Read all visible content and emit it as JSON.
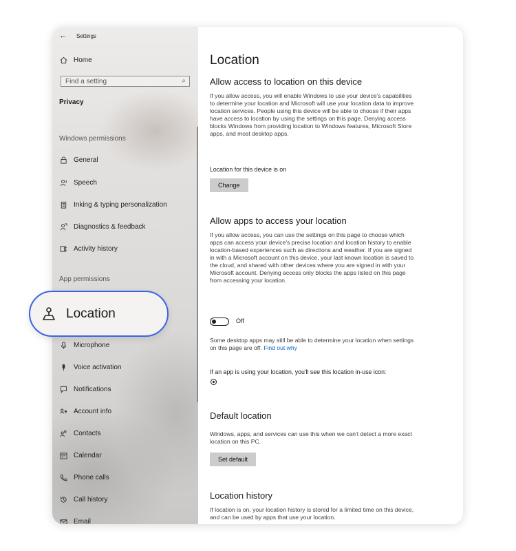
{
  "window": {
    "title": "Settings"
  },
  "sidebar": {
    "home": "Home",
    "search_placeholder": "Find a setting",
    "category": "Privacy",
    "windows_permissions_title": "Windows permissions",
    "windows_items": [
      {
        "label": "General",
        "icon": "lock-icon"
      },
      {
        "label": "Speech",
        "icon": "speech-icon"
      },
      {
        "label": "Inking & typing personalization",
        "icon": "clipboard-icon"
      },
      {
        "label": "Diagnostics & feedback",
        "icon": "feedback-icon"
      },
      {
        "label": "Activity history",
        "icon": "timeline-icon"
      }
    ],
    "app_permissions_title": "App permissions",
    "selected_item": "Location",
    "app_items": [
      {
        "label": "Microphone",
        "icon": "microphone-icon"
      },
      {
        "label": "Voice activation",
        "icon": "voice-icon"
      },
      {
        "label": "Notifications",
        "icon": "notifications-icon"
      },
      {
        "label": "Account info",
        "icon": "account-icon"
      },
      {
        "label": "Contacts",
        "icon": "contacts-icon"
      },
      {
        "label": "Calendar",
        "icon": "calendar-icon"
      },
      {
        "label": "Phone calls",
        "icon": "phone-icon"
      },
      {
        "label": "Call history",
        "icon": "history-icon"
      },
      {
        "label": "Email",
        "icon": "email-icon"
      }
    ]
  },
  "main": {
    "title": "Location",
    "device_section": {
      "heading": "Allow access to location on this device",
      "description": "If you allow access, you will enable Windows to use your device's capabilities to determine your location and Microsoft will use your location data to improve location services. People using this device will be able to choose if their apps have access to location by using the settings on this page. Denying access blocks Windows from providing location to Windows features, Microsoft Store apps, and most desktop apps.",
      "status": "Location for this device is on",
      "button": "Change"
    },
    "apps_section": {
      "heading": "Allow apps to access your location",
      "description": "If you allow access, you can use the settings on this page to choose which apps can access your device's precise location and location history to enable location-based experiences such as directions and weather. If you are signed in with a Microsoft account on this device, your last known location is saved to the cloud, and shared with other devices where you are signed in with your Microsoft account. Denying access only blocks the apps listed on this page from accessing your location.",
      "toggle_label": "Off",
      "toggle_on": false,
      "desktop_note": "Some desktop apps may still be able to determine your location when settings on this page are off.",
      "find_out_link": "Find out why",
      "inuse_note": "If an app is using your location, you'll see this location in-use icon:"
    },
    "default_section": {
      "heading": "Default location",
      "description": "Windows, apps, and services can use this when we can't detect a more exact location on this PC.",
      "button": "Set default"
    },
    "history_section": {
      "heading": "Location history",
      "description": "If location is on, your location history is stored for a limited time on this device, and can be used by apps that use your location."
    }
  },
  "colors": {
    "accent": "#3d64e4",
    "link": "#0067c0",
    "button": "#cccccc"
  }
}
